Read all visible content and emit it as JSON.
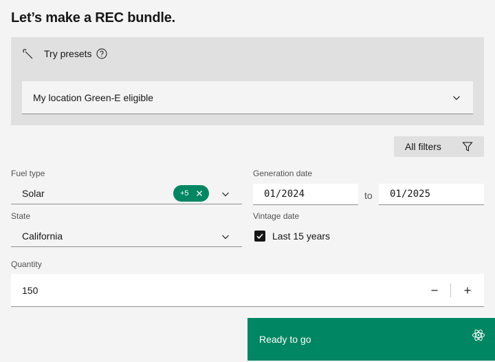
{
  "title": "Let’s make a REC bundle.",
  "presets": {
    "label": "Try presets",
    "selected": "My location Green-E eligible"
  },
  "filters": {
    "all_label": "All filters"
  },
  "fuel": {
    "label": "Fuel type",
    "value": "Solar",
    "extra_count": "+5"
  },
  "generation": {
    "label": "Generation date",
    "from": "01/2024",
    "to_label": "to",
    "to": "01/2025"
  },
  "state": {
    "label": "State",
    "value": "California"
  },
  "vintage": {
    "label": "Vintage date",
    "option": "Last 15 years",
    "checked": true
  },
  "quantity": {
    "label": "Quantity",
    "value": "150"
  },
  "cta": {
    "label": "Ready to go"
  },
  "colors": {
    "accent": "#008662",
    "panel": "#e0e0e0",
    "background": "#f4f4f4"
  }
}
